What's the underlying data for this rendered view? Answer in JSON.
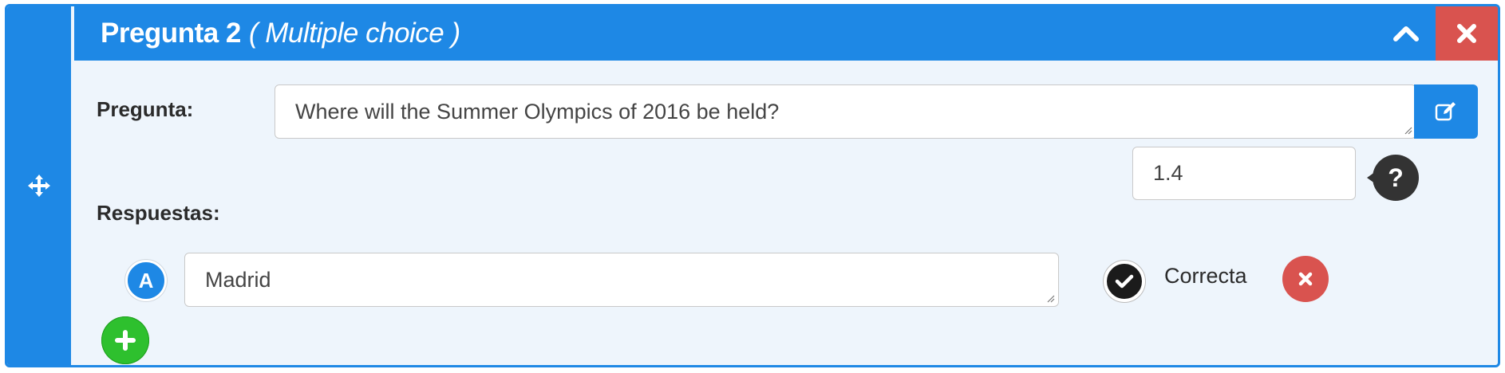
{
  "header": {
    "title": "Pregunta 2",
    "question_type": "( Multiple choice )"
  },
  "question": {
    "label": "Pregunta:",
    "value": "Where will the Summer Olympics of 2016 be held?"
  },
  "score": {
    "value": "1.4"
  },
  "answers": {
    "label": "Respuestas:",
    "items": [
      {
        "letter": "A",
        "value": "Madrid",
        "correct_label": "Correcta"
      }
    ]
  },
  "colors": {
    "primary": "#1e88e5",
    "danger": "#d9534f",
    "success": "#2ec02e",
    "panel_bg": "#eef5fc"
  },
  "icons": {
    "drag": "move-arrows-icon",
    "collapse": "chevron-up-icon",
    "close": "close-icon",
    "edit": "edit-icon",
    "help": "question-mark-icon",
    "check": "check-circle-icon",
    "add": "plus-icon"
  }
}
